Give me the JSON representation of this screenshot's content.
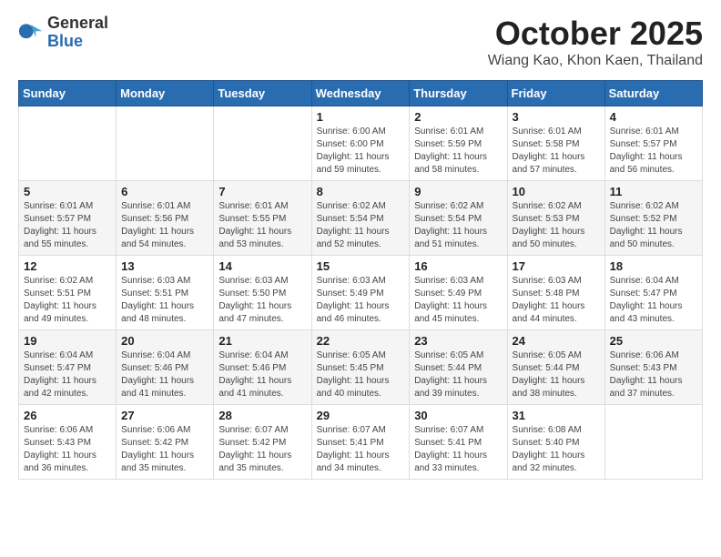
{
  "header": {
    "logo_general": "General",
    "logo_blue": "Blue",
    "month_title": "October 2025",
    "location": "Wiang Kao, Khon Kaen, Thailand"
  },
  "weekdays": [
    "Sunday",
    "Monday",
    "Tuesday",
    "Wednesday",
    "Thursday",
    "Friday",
    "Saturday"
  ],
  "weeks": [
    [
      {
        "day": "",
        "info": ""
      },
      {
        "day": "",
        "info": ""
      },
      {
        "day": "",
        "info": ""
      },
      {
        "day": "1",
        "info": "Sunrise: 6:00 AM\nSunset: 6:00 PM\nDaylight: 11 hours\nand 59 minutes."
      },
      {
        "day": "2",
        "info": "Sunrise: 6:01 AM\nSunset: 5:59 PM\nDaylight: 11 hours\nand 58 minutes."
      },
      {
        "day": "3",
        "info": "Sunrise: 6:01 AM\nSunset: 5:58 PM\nDaylight: 11 hours\nand 57 minutes."
      },
      {
        "day": "4",
        "info": "Sunrise: 6:01 AM\nSunset: 5:57 PM\nDaylight: 11 hours\nand 56 minutes."
      }
    ],
    [
      {
        "day": "5",
        "info": "Sunrise: 6:01 AM\nSunset: 5:57 PM\nDaylight: 11 hours\nand 55 minutes."
      },
      {
        "day": "6",
        "info": "Sunrise: 6:01 AM\nSunset: 5:56 PM\nDaylight: 11 hours\nand 54 minutes."
      },
      {
        "day": "7",
        "info": "Sunrise: 6:01 AM\nSunset: 5:55 PM\nDaylight: 11 hours\nand 53 minutes."
      },
      {
        "day": "8",
        "info": "Sunrise: 6:02 AM\nSunset: 5:54 PM\nDaylight: 11 hours\nand 52 minutes."
      },
      {
        "day": "9",
        "info": "Sunrise: 6:02 AM\nSunset: 5:54 PM\nDaylight: 11 hours\nand 51 minutes."
      },
      {
        "day": "10",
        "info": "Sunrise: 6:02 AM\nSunset: 5:53 PM\nDaylight: 11 hours\nand 50 minutes."
      },
      {
        "day": "11",
        "info": "Sunrise: 6:02 AM\nSunset: 5:52 PM\nDaylight: 11 hours\nand 50 minutes."
      }
    ],
    [
      {
        "day": "12",
        "info": "Sunrise: 6:02 AM\nSunset: 5:51 PM\nDaylight: 11 hours\nand 49 minutes."
      },
      {
        "day": "13",
        "info": "Sunrise: 6:03 AM\nSunset: 5:51 PM\nDaylight: 11 hours\nand 48 minutes."
      },
      {
        "day": "14",
        "info": "Sunrise: 6:03 AM\nSunset: 5:50 PM\nDaylight: 11 hours\nand 47 minutes."
      },
      {
        "day": "15",
        "info": "Sunrise: 6:03 AM\nSunset: 5:49 PM\nDaylight: 11 hours\nand 46 minutes."
      },
      {
        "day": "16",
        "info": "Sunrise: 6:03 AM\nSunset: 5:49 PM\nDaylight: 11 hours\nand 45 minutes."
      },
      {
        "day": "17",
        "info": "Sunrise: 6:03 AM\nSunset: 5:48 PM\nDaylight: 11 hours\nand 44 minutes."
      },
      {
        "day": "18",
        "info": "Sunrise: 6:04 AM\nSunset: 5:47 PM\nDaylight: 11 hours\nand 43 minutes."
      }
    ],
    [
      {
        "day": "19",
        "info": "Sunrise: 6:04 AM\nSunset: 5:47 PM\nDaylight: 11 hours\nand 42 minutes."
      },
      {
        "day": "20",
        "info": "Sunrise: 6:04 AM\nSunset: 5:46 PM\nDaylight: 11 hours\nand 41 minutes."
      },
      {
        "day": "21",
        "info": "Sunrise: 6:04 AM\nSunset: 5:46 PM\nDaylight: 11 hours\nand 41 minutes."
      },
      {
        "day": "22",
        "info": "Sunrise: 6:05 AM\nSunset: 5:45 PM\nDaylight: 11 hours\nand 40 minutes."
      },
      {
        "day": "23",
        "info": "Sunrise: 6:05 AM\nSunset: 5:44 PM\nDaylight: 11 hours\nand 39 minutes."
      },
      {
        "day": "24",
        "info": "Sunrise: 6:05 AM\nSunset: 5:44 PM\nDaylight: 11 hours\nand 38 minutes."
      },
      {
        "day": "25",
        "info": "Sunrise: 6:06 AM\nSunset: 5:43 PM\nDaylight: 11 hours\nand 37 minutes."
      }
    ],
    [
      {
        "day": "26",
        "info": "Sunrise: 6:06 AM\nSunset: 5:43 PM\nDaylight: 11 hours\nand 36 minutes."
      },
      {
        "day": "27",
        "info": "Sunrise: 6:06 AM\nSunset: 5:42 PM\nDaylight: 11 hours\nand 35 minutes."
      },
      {
        "day": "28",
        "info": "Sunrise: 6:07 AM\nSunset: 5:42 PM\nDaylight: 11 hours\nand 35 minutes."
      },
      {
        "day": "29",
        "info": "Sunrise: 6:07 AM\nSunset: 5:41 PM\nDaylight: 11 hours\nand 34 minutes."
      },
      {
        "day": "30",
        "info": "Sunrise: 6:07 AM\nSunset: 5:41 PM\nDaylight: 11 hours\nand 33 minutes."
      },
      {
        "day": "31",
        "info": "Sunrise: 6:08 AM\nSunset: 5:40 PM\nDaylight: 11 hours\nand 32 minutes."
      },
      {
        "day": "",
        "info": ""
      }
    ]
  ]
}
